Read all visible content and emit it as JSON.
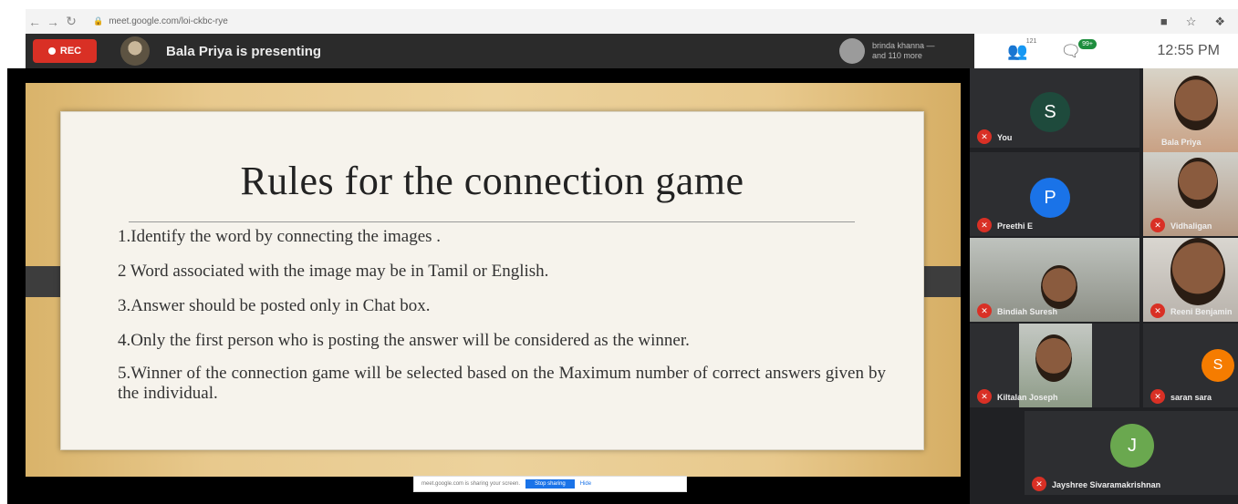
{
  "browser": {
    "url": "meet.google.com/loi-ckbc-rye"
  },
  "meet_bar": {
    "rec_label": "REC",
    "presenting_text": "Bala Priya is presenting",
    "viewers_line1": "brinda khanna —",
    "viewers_line2": "and 110 more",
    "participants_count": "121",
    "chat_count": "99+",
    "time": "12:55 PM"
  },
  "slide": {
    "title": "Rules for the connection game",
    "rules": [
      "1.Identify the word by connecting the images .",
      "2 Word associated with the image may be in Tamil or English.",
      "3.Answer should be posted only in Chat box.",
      "4.Only the first person who is posting the answer will be considered as the winner.",
      "5.Winner of the connection game will be selected based on the Maximum number of correct answers given by the individual."
    ]
  },
  "share_strip": {
    "text": "meet.google.com is sharing your screen.",
    "stop_label": "Stop sharing",
    "hide_label": "Hide"
  },
  "participants": [
    {
      "name": "You",
      "initial": "S"
    },
    {
      "name": "Bala Priya"
    },
    {
      "name": "Preethi E",
      "initial": "P"
    },
    {
      "name": "Vidhaligan"
    },
    {
      "name": "Bindiah Suresh"
    },
    {
      "name": "Reeni Benjamin"
    },
    {
      "name": "Kiltalan Joseph"
    },
    {
      "name": "saran sara",
      "initial": "S"
    },
    {
      "name": "Jayshree Sivaramakrishnan",
      "initial": "J"
    }
  ],
  "colors": {
    "rec": "#d93025",
    "s_avatar": "#1e4a3c",
    "p_avatar": "#1a73e8",
    "s_orange": "#f57c00",
    "j_avatar": "#6aa84f"
  }
}
